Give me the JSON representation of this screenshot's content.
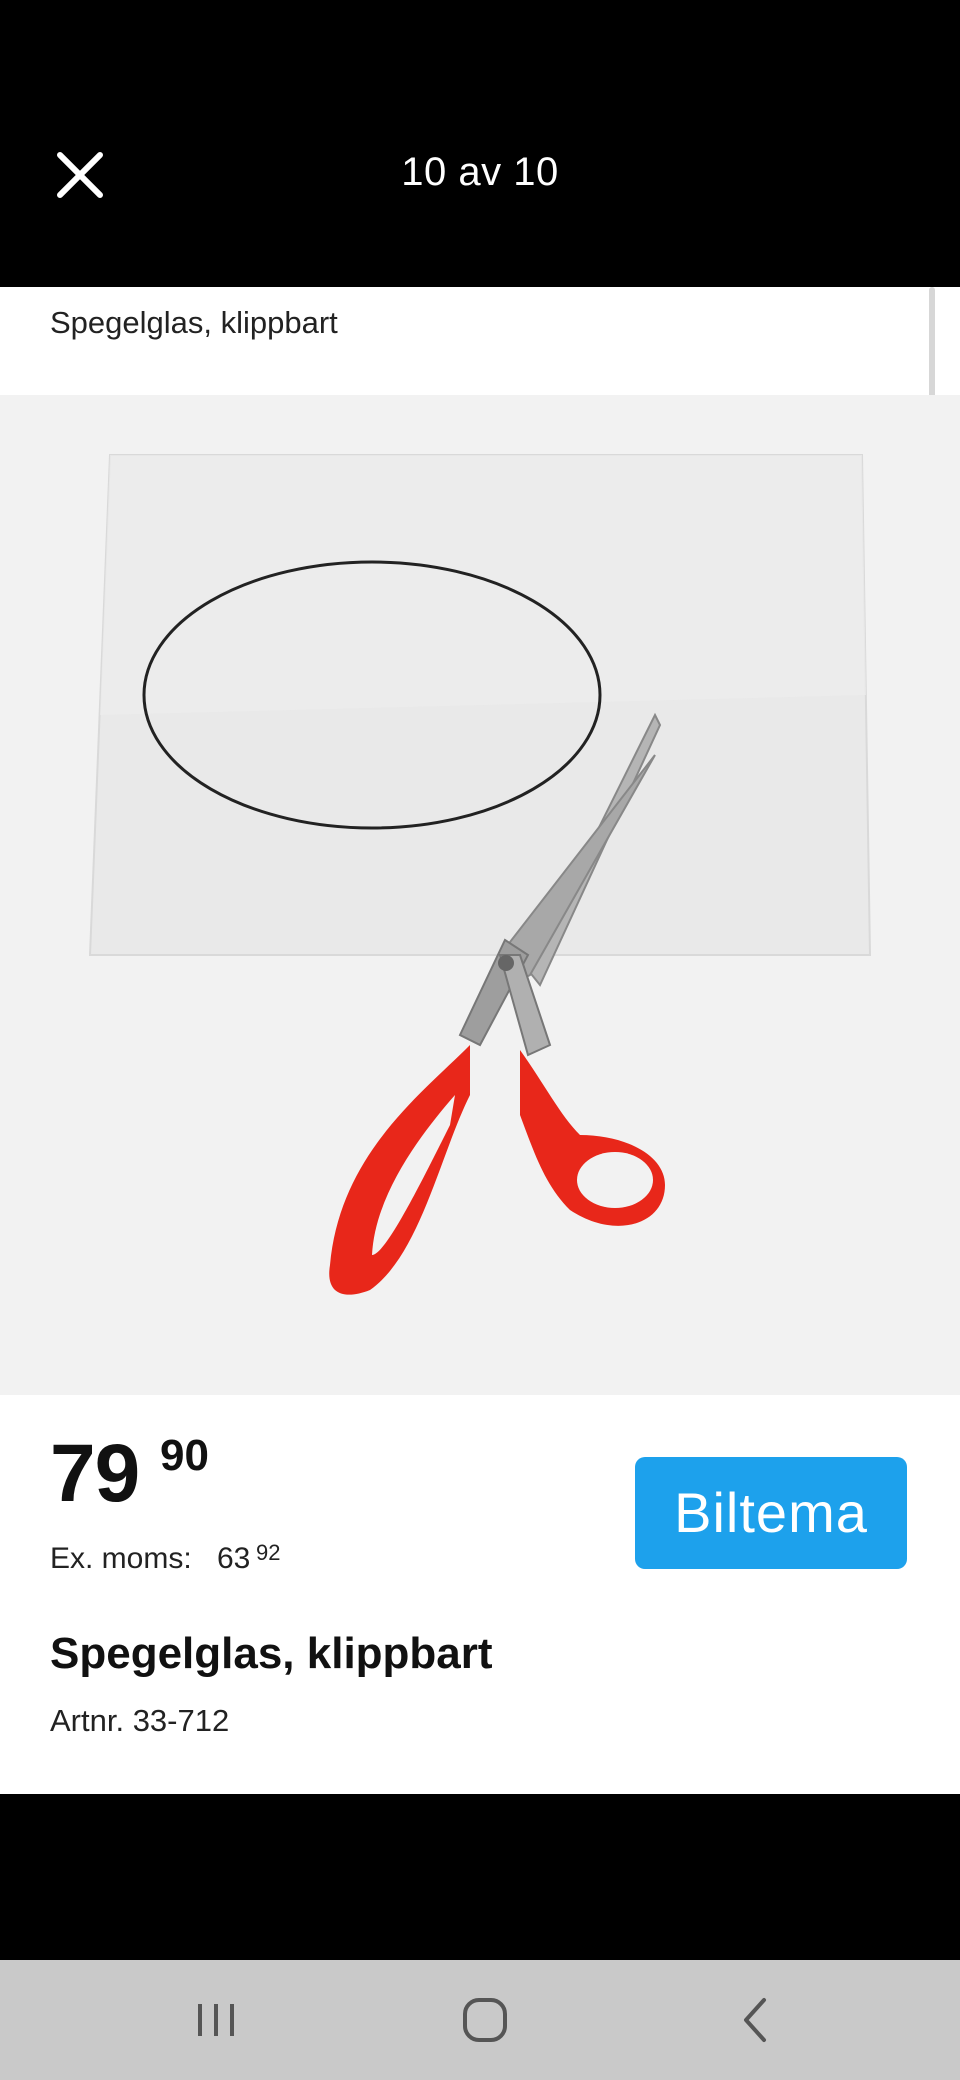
{
  "header": {
    "counter": "10 av 10",
    "close_icon": "close-icon"
  },
  "gallery": {
    "title": "Spegelglas, klippbart",
    "image_desc_icon": "product-image"
  },
  "product": {
    "price_main": "79",
    "price_cents": "90",
    "exvat_label": "Ex. moms:",
    "exvat_main": "63",
    "exvat_cents": "92",
    "brand": "Biltema",
    "title": "Spegelglas, klippbart",
    "article": "Artnr. 33-712"
  },
  "navbar": {
    "recent_icon": "recent-apps-icon",
    "home_icon": "home-icon",
    "back_icon": "back-icon"
  },
  "colors": {
    "brand": "#1da1ec",
    "scissors_handle": "#e8271a"
  }
}
